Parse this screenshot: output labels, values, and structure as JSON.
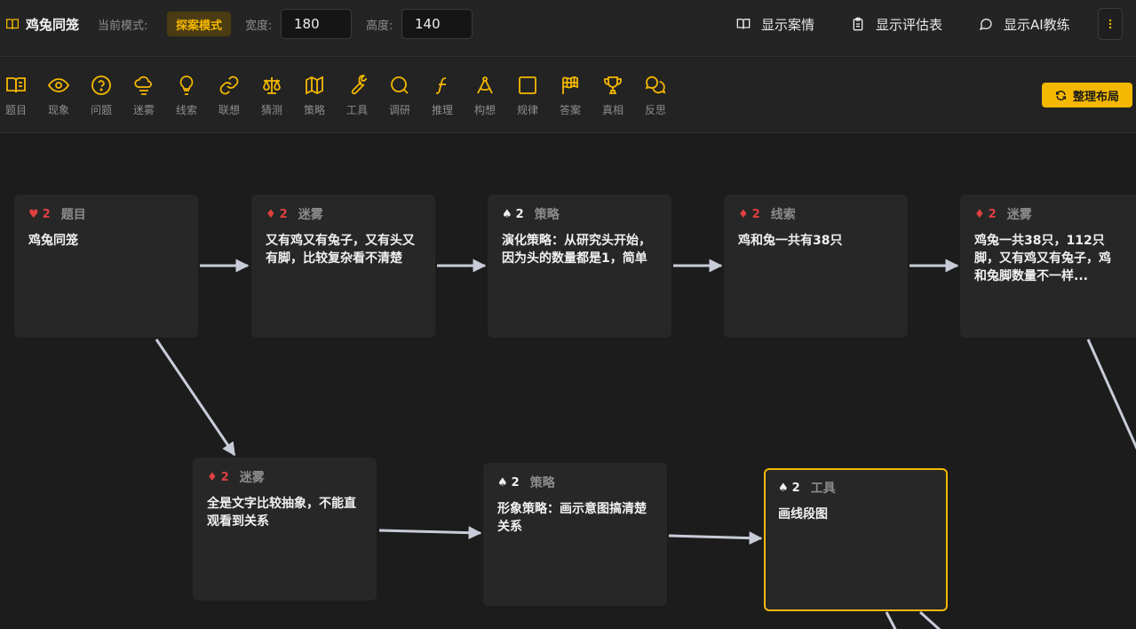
{
  "header": {
    "title": "鸡兔同笼",
    "mode_label": "当前模式:",
    "mode_value": "探案模式",
    "width_label": "宽度:",
    "width_value": "180",
    "height_label": "高度:",
    "height_value": "140",
    "buttons": [
      {
        "label": "显示案情",
        "icon": "book-open-icon"
      },
      {
        "label": "显示评估表",
        "icon": "clipboard-icon"
      },
      {
        "label": "显示AI教练",
        "icon": "chat-icon"
      }
    ],
    "more_icon": "more-vertical-icon"
  },
  "toolbar": {
    "tools": [
      {
        "label": "题目",
        "icon": "book-open-icon"
      },
      {
        "label": "现象",
        "icon": "eye-icon"
      },
      {
        "label": "问题",
        "icon": "question-icon"
      },
      {
        "label": "迷雾",
        "icon": "cloud-fog-icon"
      },
      {
        "label": "线索",
        "icon": "lightbulb-icon"
      },
      {
        "label": "联想",
        "icon": "link-icon"
      },
      {
        "label": "猜测",
        "icon": "scale-icon"
      },
      {
        "label": "策略",
        "icon": "map-icon"
      },
      {
        "label": "工具",
        "icon": "wrench-icon"
      },
      {
        "label": "调研",
        "icon": "search-icon"
      },
      {
        "label": "推理",
        "icon": "function-icon"
      },
      {
        "label": "构想",
        "icon": "compass-icon"
      },
      {
        "label": "规律",
        "icon": "square-icon"
      },
      {
        "label": "答案",
        "icon": "flag-icon"
      },
      {
        "label": "真相",
        "icon": "trophy-icon"
      },
      {
        "label": "反思",
        "icon": "chat-bubbles-icon"
      }
    ],
    "arrange_label": "整理布局"
  },
  "colors": {
    "accent": "#f5b800",
    "red_suit": "#e04040",
    "edge": "#c8ccd8"
  },
  "nodes": [
    {
      "suit": "♥",
      "suit_color": "red",
      "level": "2",
      "type": "题目",
      "text": "鸡兔同笼"
    },
    {
      "suit": "♦",
      "suit_color": "red",
      "level": "2",
      "type": "迷雾",
      "text": "又有鸡又有兔子，又有头又有脚，比较复杂看不清楚"
    },
    {
      "suit": "♠",
      "suit_color": "white",
      "level": "2",
      "type": "策略",
      "text": "演化策略：从研究头开始，因为头的数量都是1，简单"
    },
    {
      "suit": "♦",
      "suit_color": "red",
      "level": "2",
      "type": "线索",
      "text": "鸡和兔一共有38只"
    },
    {
      "suit": "♦",
      "suit_color": "red",
      "level": "2",
      "type": "迷雾",
      "text": "鸡兔一共38只，112只脚，又有鸡又有兔子，鸡和兔脚数量不一样..."
    },
    {
      "suit": "♦",
      "suit_color": "red",
      "level": "2",
      "type": "迷雾",
      "text": "全是文字比较抽象，不能直观看到关系"
    },
    {
      "suit": "♠",
      "suit_color": "white",
      "level": "2",
      "type": "策略",
      "text": "形象策略：画示意图搞清楚关系"
    },
    {
      "suit": "♠",
      "suit_color": "white",
      "level": "2",
      "type": "工具",
      "text": "画线段图",
      "selected": true
    }
  ]
}
